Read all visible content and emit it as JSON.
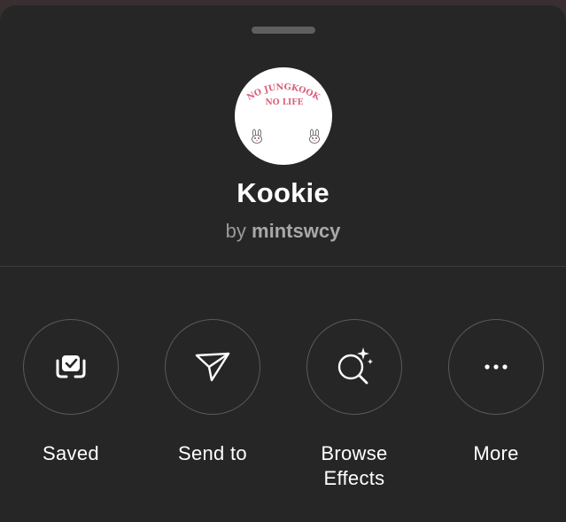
{
  "effect": {
    "name": "Kookie",
    "by_prefix": "by",
    "author": "mintswcy",
    "avatar_text_line1": "NO JUNGKOOK",
    "avatar_text_line2": "NO LIFE",
    "avatar_text_color": "#d9607a"
  },
  "actions": [
    {
      "label": "Saved",
      "icon": "saved-check-icon"
    },
    {
      "label": "Send to",
      "icon": "send-icon"
    },
    {
      "label": "Browse\nEffects",
      "icon": "browse-effects-icon"
    },
    {
      "label": "More",
      "icon": "more-icon"
    }
  ],
  "colors": {
    "sheet_background": "#262626",
    "text_primary": "#ffffff",
    "text_secondary": "#9a9a9a",
    "circle_border": "#5a5a5a"
  }
}
